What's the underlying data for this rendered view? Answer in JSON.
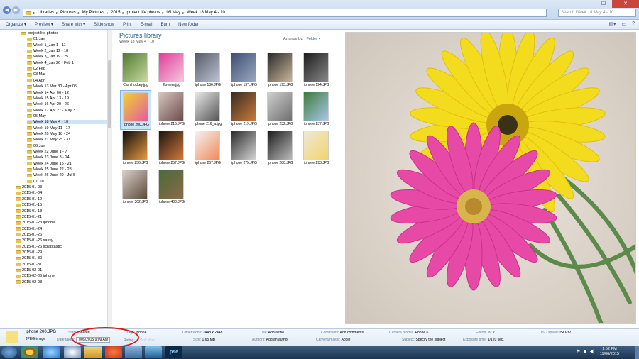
{
  "titlebar": {
    "breadcrumb": [
      "Libraries",
      "Pictures",
      "My Pictures",
      "2015",
      "project life photos",
      "05 May",
      "Week 18 May 4 - 10"
    ],
    "search_placeholder": "Search Week 18 May 4 - 10",
    "minimize_icon": "minimize-icon",
    "maximize_icon": "maximize-icon",
    "close_icon": "close-icon"
  },
  "toolbar": {
    "organize": "Organize ▾",
    "preview": "Preview ▾",
    "share_with": "Share with ▾",
    "slide_show": "Slide show",
    "print": "Print",
    "email": "E-mail",
    "burn": "Burn",
    "new_folder": "New folder"
  },
  "nav": {
    "root": "project life photos",
    "months": [
      {
        "name": "01 Jan",
        "weeks": [
          "Week 1_Jan 1 - 11",
          "Week 2_Jan 12 - 18",
          "Week 3_Jan 19 - 25",
          "Week 4_Jan 26 - Feb 1"
        ]
      },
      {
        "name": "02 Feb",
        "weeks": []
      },
      {
        "name": "03 Mar",
        "weeks": []
      },
      {
        "name": "04 Apr",
        "weeks": [
          "Week 13 Mar 30 - Apr 05",
          "Week 14 Apr 06 - 12",
          "Week 15 Apr 13 - 19",
          "Week 16 Apr 20 - 26",
          "Week 17 Apr 27 - May 3"
        ]
      },
      {
        "name": "05 May",
        "weeks": [
          "Week 18 May 4 - 10",
          "Week 19 May 11 - 17",
          "Week 20 May 18 - 24",
          "Week 21 May 25 - 31"
        ]
      },
      {
        "name": "06 Jun",
        "weeks": [
          "Week 22 June 1 - 7",
          "Week 23 June 8 - 14",
          "Week 24 June 15 - 21",
          "Week 25 June 22 - 28",
          "Week 26 June 29 - Jul 5"
        ]
      },
      {
        "name": "07 Jul",
        "weeks": []
      }
    ],
    "folders": [
      "2015-01-03",
      "2015-01-04",
      "2015-01-12",
      "2015-01-15",
      "2015-01-18",
      "2015-01-21",
      "2015-01-23 iphone",
      "2015-01-24",
      "2015-01-26",
      "2015-01-26 sassy",
      "2015-01-26 scraptastic",
      "2015-01-29",
      "2015-01-30",
      "2015-01-31",
      "2015-02-01",
      "2015-02-06 iphone",
      "2015-02-08"
    ]
  },
  "content": {
    "title": "Pictures library",
    "subtitle": "Week 18 May 4 - 10",
    "arrange_label": "Arrange by:",
    "arrange_value": "Folder ▾",
    "files": [
      "Cam hockey.jpg",
      "flowers.jpg",
      "iphone 136.JPG",
      "iphone 137.JPG",
      "iphone 193.JPG",
      "iphone 194.JPG",
      "iphone 200.JPG",
      "iphone 216.JPG",
      "iphone 216_a.jpg",
      "iphone 219.JPG",
      "iphone 232.JPG",
      "iphone 237.JPG",
      "iphone 256.JPG",
      "iphone 257.JPG",
      "iphone 267.JPG",
      "iphone 275.JPG",
      "iphone 280.JPG",
      "iphone 293.JPG",
      "iphone 302.JPG",
      "iphone 408.JPG"
    ],
    "selected_file": "iphone 200.JPG"
  },
  "details": {
    "file_name": "iphone 200.JPG",
    "file_type": "JPEG image",
    "state_label": "State:",
    "state_value": "Shared",
    "date_label": "Date taken:",
    "date_value": "7/05/2015 9:09 AM",
    "tags_label": "Tags:",
    "tags_value": "iphone",
    "rating_label": "Rating:",
    "rating_value": "☆☆☆☆☆",
    "dimensions_label": "Dimensions:",
    "dimensions_value": "2448 x 2448",
    "size_label": "Size:",
    "size_value": "1.65 MB",
    "title_label": "Title:",
    "title_value": "Add a title",
    "authors_label": "Authors:",
    "authors_value": "Add an author",
    "comments_label": "Comments:",
    "comments_value": "Add comments",
    "maker_label": "Camera maker:",
    "maker_value": "Apple",
    "model_label": "Camera model:",
    "model_value": "iPhone 6",
    "subject_label": "Subject:",
    "subject_value": "Specify the subject",
    "fstop_label": "F-stop:",
    "fstop_value": "f/2.2",
    "exposure_label": "Exposure time:",
    "exposure_value": "1/120 sec.",
    "iso_label": "ISO speed:",
    "iso_value": "ISO-32"
  },
  "taskbar": {
    "ps_label": "pse",
    "time": "1:52 PM",
    "date": "11/06/2015"
  },
  "colors": {
    "accent": "#1e5f8a",
    "selection": "#cce2f7",
    "annotation": "#e01818"
  }
}
